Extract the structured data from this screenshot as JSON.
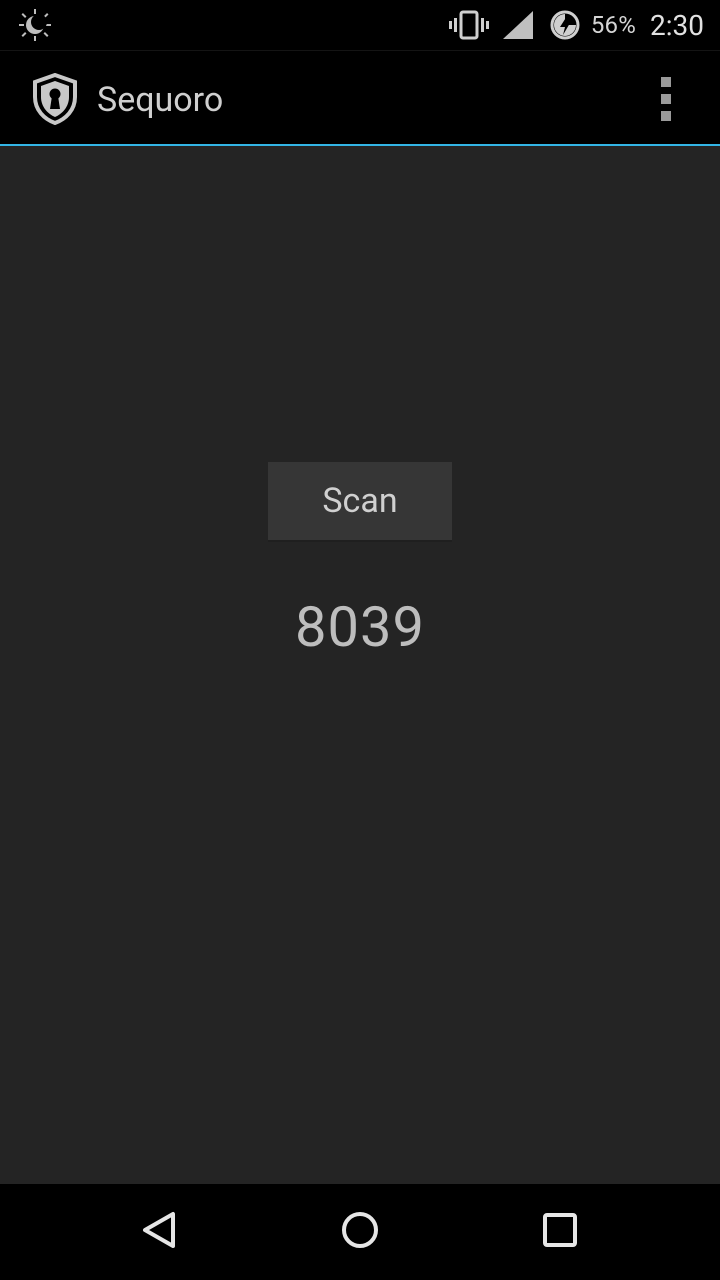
{
  "status_bar": {
    "battery_percent": "56%",
    "time": "2:30",
    "icons": [
      "night-mode-icon",
      "vibrate-icon",
      "cell-signal-icon",
      "battery-charging-icon"
    ]
  },
  "action_bar": {
    "title": "Sequoro",
    "logo_icon": "shield-keyhole-icon",
    "overflow_icon": "overflow-menu-icon"
  },
  "main": {
    "scan_button_label": "Scan",
    "result_value": "8039"
  },
  "nav_bar": {
    "icons": [
      "back-icon",
      "home-icon",
      "recents-icon"
    ]
  },
  "colors": {
    "background": "#242424",
    "bar_background": "#000000",
    "accent": "#33b5e5",
    "button_background": "#363636",
    "text_primary": "#cfcfcf"
  }
}
